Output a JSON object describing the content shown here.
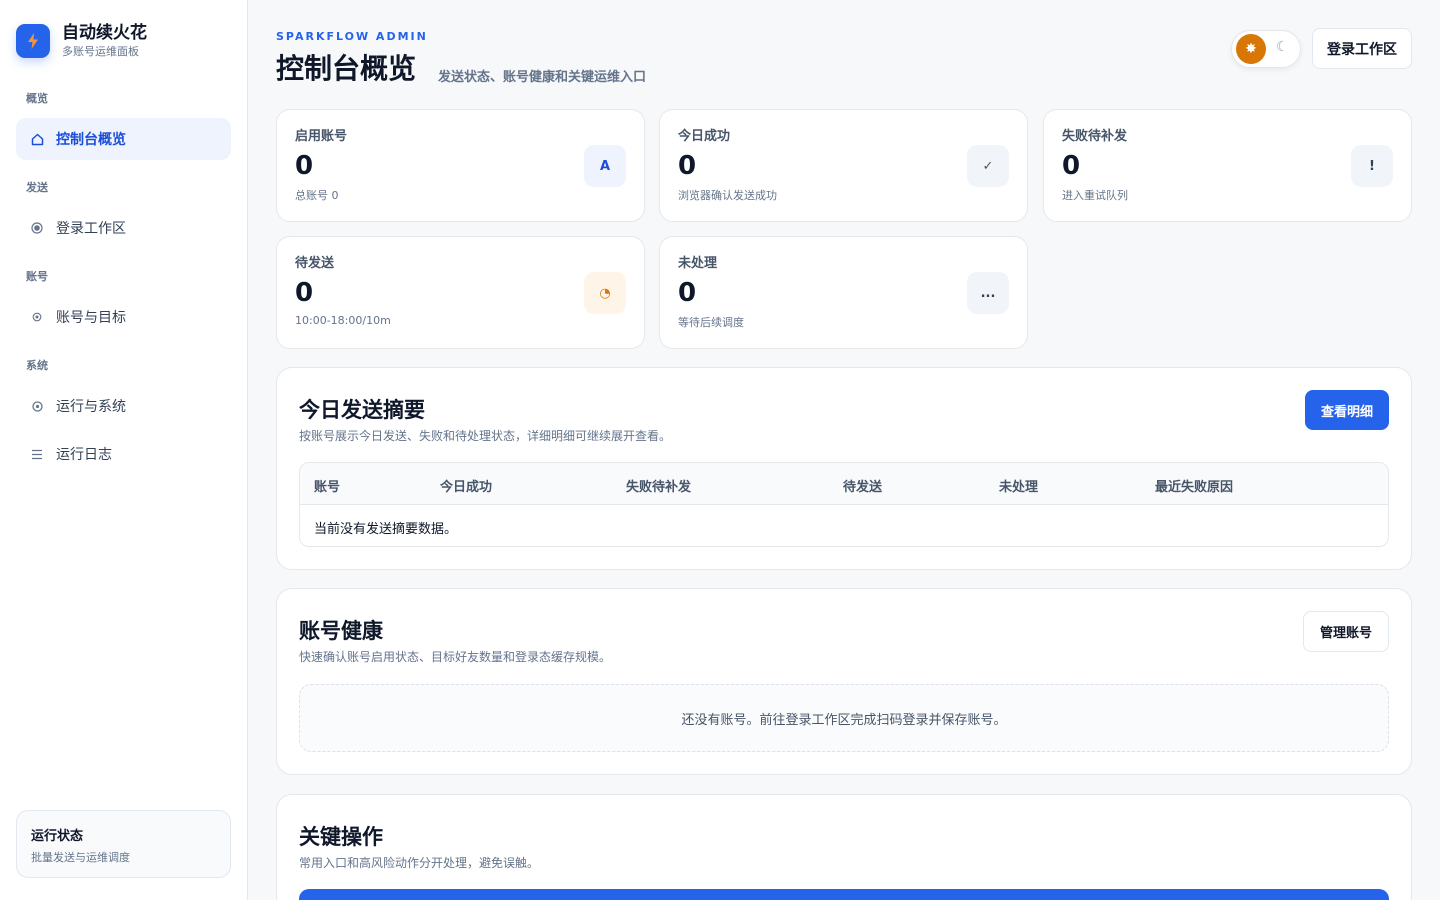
{
  "brand": {
    "title": "自动续火花",
    "subtitle": "多账号运维面板"
  },
  "sidebar": {
    "sections": [
      {
        "label": "概览"
      },
      {
        "label": "发送"
      },
      {
        "label": "账号"
      },
      {
        "label": "系统"
      }
    ],
    "items": [
      {
        "label": "控制台概览",
        "icon": "home-icon",
        "active": true
      },
      {
        "label": "登录工作区",
        "icon": "radio-dot-icon"
      },
      {
        "label": "账号与目标",
        "icon": "target-icon"
      },
      {
        "label": "运行与系统",
        "icon": "gear-icon"
      },
      {
        "label": "运行日志",
        "icon": "list-icon"
      }
    ],
    "status": {
      "title": "运行状态",
      "subtitle": "批量发送与运维调度"
    }
  },
  "header": {
    "eyebrow": "SPARKFLOW ADMIN",
    "title": "控制台概览",
    "subtitle": "发送状态、账号健康和关键运维入口",
    "login_button": "登录工作区"
  },
  "stats": [
    {
      "label": "启用账号",
      "value": "0",
      "note": "总账号 0",
      "icon_glyph": "A",
      "icon_name": "account-icon",
      "icon_bg": "#eef3fd",
      "icon_color": "#1d4ed8"
    },
    {
      "label": "今日成功",
      "value": "0",
      "note": "浏览器确认发送成功",
      "icon_glyph": "✓",
      "icon_name": "check-icon",
      "icon_bg": "#f1f5f9",
      "icon_color": "#475569"
    },
    {
      "label": "失败待补发",
      "value": "0",
      "note": "进入重试队列",
      "icon_glyph": "!",
      "icon_name": "alert-icon",
      "icon_bg": "#f1f5f9",
      "icon_color": "#334155"
    },
    {
      "label": "待发送",
      "value": "0",
      "note": "10:00-18:00/10m",
      "icon_glyph": "◔",
      "icon_name": "clock-icon",
      "icon_bg": "#fff4e8",
      "icon_color": "#d97706"
    },
    {
      "label": "未处理",
      "value": "0",
      "note": "等待后续调度",
      "icon_glyph": "...",
      "icon_name": "more-icon",
      "icon_bg": "#f1f5f9",
      "icon_color": "#334155"
    }
  ],
  "summary": {
    "title": "今日发送摘要",
    "subtitle": "按账号展示今日发送、失败和待处理状态，详细明细可继续展开查看。",
    "button": "查看明细",
    "columns": [
      "账号",
      "今日成功",
      "失败待补发",
      "待发送",
      "未处理",
      "最近失败原因"
    ],
    "empty": "当前没有发送摘要数据。"
  },
  "health": {
    "title": "账号健康",
    "subtitle": "快速确认账号启用状态、目标好友数量和登录态缓存规模。",
    "button": "管理账号",
    "empty": "还没有账号。前往登录工作区完成扫码登录并保存账号。"
  },
  "actions": {
    "title": "关键操作",
    "subtitle": "常用入口和高风险动作分开处理，避免误触。"
  },
  "colors": {
    "accent": "#2563eb",
    "warning": "#d97706"
  }
}
